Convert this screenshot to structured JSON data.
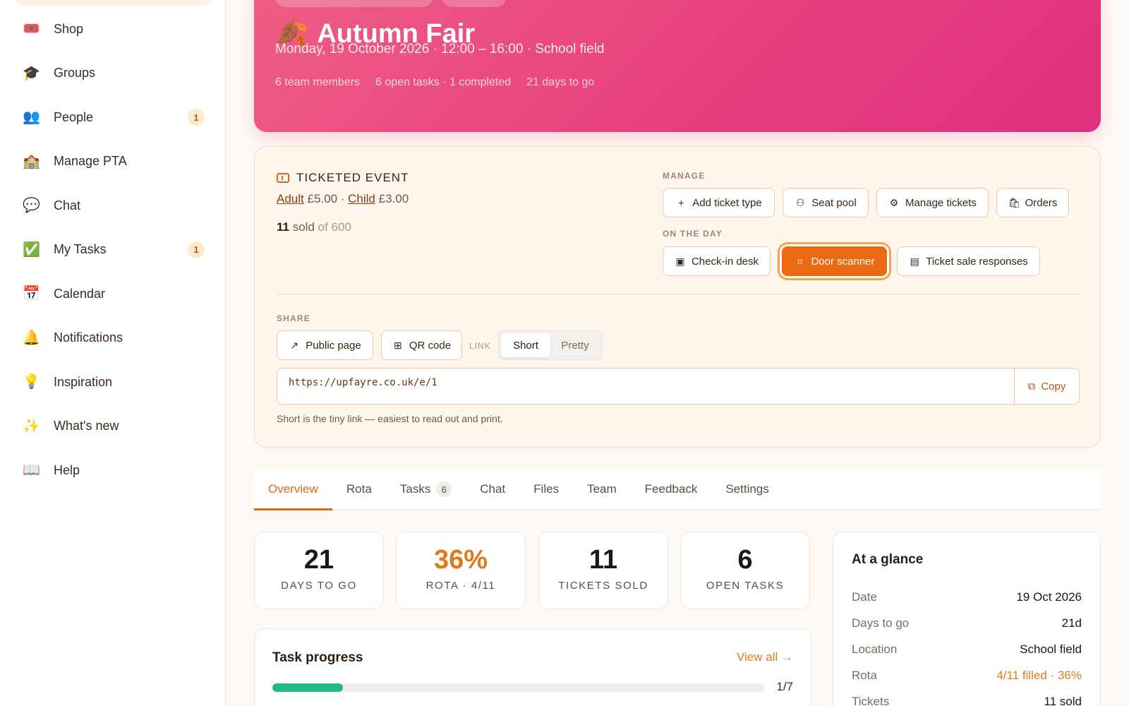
{
  "sidebar": {
    "items": [
      {
        "emoji": "🎟️",
        "icon": "ticket-icon",
        "label": "Shop",
        "badge": ""
      },
      {
        "emoji": "🎓",
        "icon": "graduation-cap-icon",
        "label": "Groups",
        "badge": ""
      },
      {
        "emoji": "👥",
        "icon": "people-icon",
        "label": "People",
        "badge": "1"
      },
      {
        "emoji": "🏫",
        "icon": "school-icon",
        "label": "Manage PTA",
        "badge": ""
      },
      {
        "emoji": "💬",
        "icon": "speech-bubble-icon",
        "label": "Chat",
        "badge": ""
      },
      {
        "emoji": "✅",
        "icon": "check-icon",
        "label": "My Tasks",
        "badge": "1"
      },
      {
        "emoji": "📅",
        "icon": "calendar-icon",
        "label": "Calendar",
        "badge": ""
      },
      {
        "emoji": "🔔",
        "icon": "bell-icon",
        "label": "Notifications",
        "badge": ""
      },
      {
        "emoji": "💡",
        "icon": "lightbulb-icon",
        "label": "Inspiration",
        "badge": ""
      },
      {
        "emoji": "✨",
        "icon": "sparkles-icon",
        "label": "What's new",
        "badge": ""
      },
      {
        "emoji": "📖",
        "icon": "book-icon",
        "label": "Help",
        "badge": ""
      }
    ]
  },
  "hero": {
    "emoji": "🍂",
    "title": "Autumn Fair",
    "subtitle": "Monday, 19 October 2026 · 12:00 – 16:00 · School field",
    "meta": [
      "6 team members",
      "6 open tasks · 1 completed",
      "21 days to go"
    ]
  },
  "ticketing": {
    "heading": "TICKETED EVENT",
    "price_adult_label": "Adult",
    "price_adult": "£5.00",
    "price_sep": " · ",
    "price_child_label": "Child",
    "price_child": "£3.00",
    "sold_count": "11",
    "sold_word": "sold",
    "sold_of": "of 600",
    "manage_label": "MANAGE",
    "manage_buttons": [
      "Add ticket type",
      "Seat pool",
      "Manage tickets",
      "Orders"
    ],
    "on_the_day_label": "ON THE DAY",
    "day_buttons": [
      "Check-in desk",
      "Door scanner",
      "Ticket sale responses"
    ],
    "share_label": "SHARE",
    "share_buttons": [
      "Public page",
      "QR code"
    ],
    "link_label": "LINK",
    "link_options": [
      "Short",
      "Pretty"
    ],
    "url": "https://upfayre.co.uk/e/1",
    "copy_label": "Copy",
    "hint": "Short is the tiny link — easiest to read out and print."
  },
  "tabs": [
    {
      "label": "Overview",
      "count": ""
    },
    {
      "label": "Rota",
      "count": ""
    },
    {
      "label": "Tasks",
      "count": "6"
    },
    {
      "label": "Chat",
      "count": ""
    },
    {
      "label": "Files",
      "count": ""
    },
    {
      "label": "Team",
      "count": ""
    },
    {
      "label": "Feedback",
      "count": ""
    },
    {
      "label": "Settings",
      "count": ""
    }
  ],
  "stats": [
    {
      "value": "21",
      "label": "DAYS TO GO"
    },
    {
      "value": "36%",
      "label": "ROTA · 4/11"
    },
    {
      "value": "11",
      "label": "TICKETS SOLD"
    },
    {
      "value": "6",
      "label": "OPEN TASKS"
    }
  ],
  "task_progress": {
    "title": "Task progress",
    "link": "View all →",
    "completed": 1,
    "total": 7,
    "count_label": "1/7"
  },
  "glance": {
    "title": "At a glance",
    "rows": [
      {
        "key": "Date",
        "value": "19 Oct 2026"
      },
      {
        "key": "Days to go",
        "value": "21d"
      },
      {
        "key": "Location",
        "value": "School field"
      },
      {
        "key": "Rota",
        "value": "4/11 filled · 36%"
      },
      {
        "key": "Tickets",
        "value": "11 sold"
      }
    ]
  },
  "colors": {
    "accent": "#e06a1a",
    "hero_pink": "#e8427f",
    "progress_green": "#1fb98a"
  }
}
